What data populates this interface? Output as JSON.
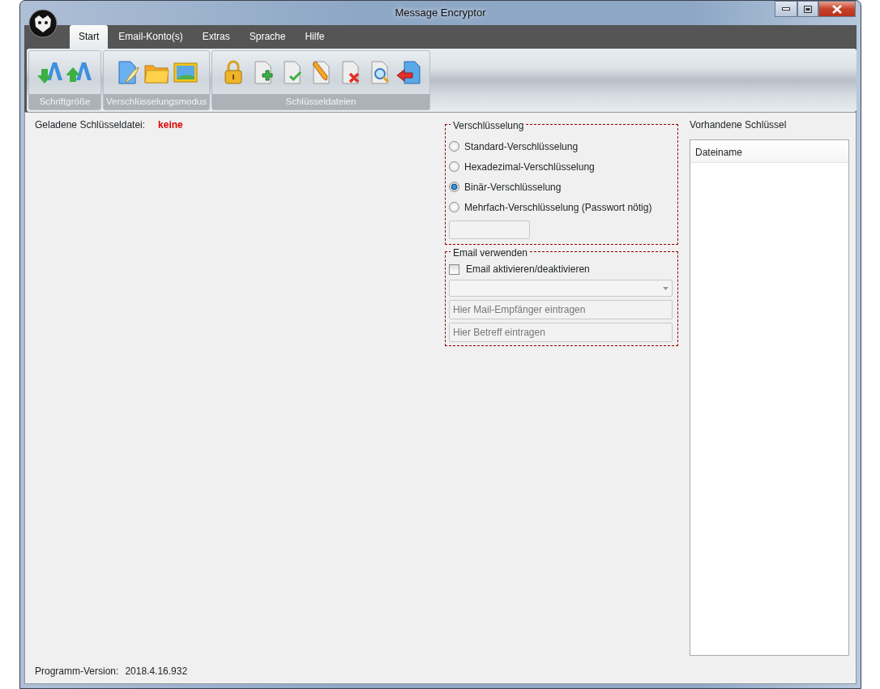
{
  "window": {
    "title": "Message Encryptor"
  },
  "tabs": [
    {
      "label": "Start",
      "selected": true
    },
    {
      "label": "Email-Konto(s)",
      "selected": false
    },
    {
      "label": "Extras",
      "selected": false
    },
    {
      "label": "Sprache",
      "selected": false
    },
    {
      "label": "Hilfe",
      "selected": false
    }
  ],
  "ribbon": [
    {
      "label": "Schriftgröße",
      "tools": [
        {
          "kind": "font-down"
        },
        {
          "kind": "font-up"
        }
      ]
    },
    {
      "label": "Verschlüsselungsmodus",
      "tools": [
        {
          "kind": "document-pen"
        },
        {
          "kind": "folder"
        },
        {
          "kind": "image"
        }
      ]
    },
    {
      "label": "Schlüsseldateien",
      "tools": [
        {
          "kind": "padlock"
        },
        {
          "kind": "doc-add"
        },
        {
          "kind": "doc-check"
        },
        {
          "kind": "doc-pencil"
        },
        {
          "kind": "doc-delete"
        },
        {
          "kind": "doc-search"
        },
        {
          "kind": "doc-back"
        }
      ]
    }
  ],
  "loaded_key": {
    "label": "Geladene Schlüsseldatei:",
    "value": "keine"
  },
  "encryption": {
    "title": "Verschlüsselung",
    "options": [
      {
        "label": "Standard-Verschlüsselung",
        "selected": false
      },
      {
        "label": "Hexadezimal-Verschlüsselung",
        "selected": false
      },
      {
        "label": "Binär-Verschlüsselung",
        "selected": true
      },
      {
        "label": "Mehrfach-Verschlüsselung (Passwort nötig)",
        "selected": false
      }
    ]
  },
  "email": {
    "title": "Email verwenden",
    "toggle": {
      "label": "Email aktivieren/deaktivieren",
      "checked": false
    },
    "recipient_placeholder": "Hier Mail-Empfänger eintragen",
    "subject_placeholder": "Hier Betreff eintragen"
  },
  "keys": {
    "title": "Vorhandene Schlüssel",
    "columns": [
      "Dateiname"
    ]
  },
  "status_bar": {
    "label": "Programm-Version:",
    "value": "2018.4.16.932"
  }
}
